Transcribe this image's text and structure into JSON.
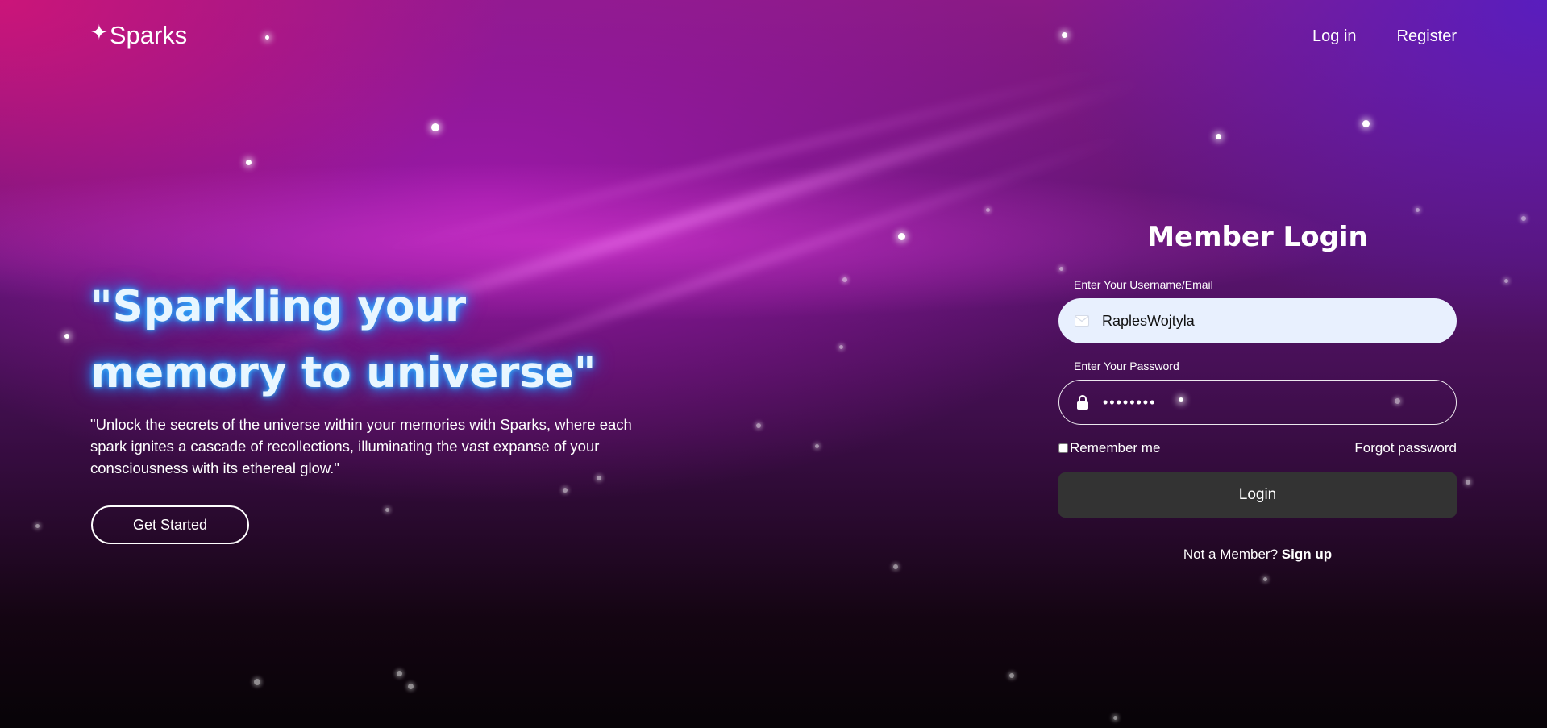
{
  "header": {
    "logo_text": "Sparks",
    "logo_icon": "sparkle-icon",
    "nav": {
      "login_label": "Log in",
      "register_label": "Register"
    }
  },
  "hero": {
    "title_line1": "\"Sparkling your",
    "title_line2": "memory to universe\"",
    "description": "\"Unlock the secrets of the universe within your memories with Sparks, where each spark ignites a cascade of recollections, illuminating the vast expanse of your consciousness with its ethereal glow.\"",
    "cta_label": "Get Started"
  },
  "login": {
    "title": "Member Login",
    "username_label": "Enter Your Username/Email",
    "username_value": "RaplesWojtyla",
    "username_icon": "envelope-icon",
    "password_label": "Enter Your Password",
    "password_value": "password",
    "password_icon": "lock-icon",
    "remember_label": "Remember me",
    "remember_checked": false,
    "forgot_label": "Forgot password",
    "submit_label": "Login",
    "signup_prompt": "Not a Member?",
    "signup_link": "Sign up"
  },
  "colors": {
    "glow_blue": "#1e9bff",
    "button_dark": "#333333",
    "input_light": "#e8f0fe"
  }
}
